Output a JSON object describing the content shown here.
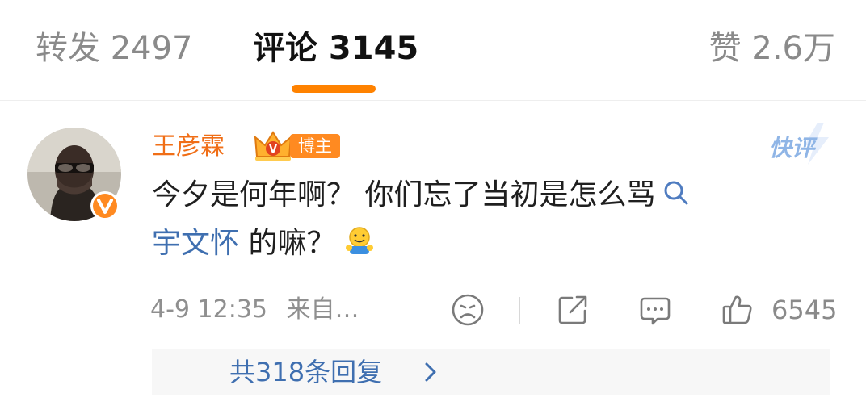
{
  "tabs": {
    "repost": "转发 2497",
    "comments": "评论 3145",
    "likes": "赞 2.6万"
  },
  "comment": {
    "username": "王彦霖",
    "badge_label": "博主",
    "quick_review": "快评",
    "text_line1": "今夕是何年啊？ 你们忘了当初是怎么骂",
    "mention_link": "宇文怀",
    "text_line2_tail": " 的嘛？",
    "time": "4-9 12:35",
    "source": "来自…",
    "like_count": "6545",
    "reply_link": "共318条回复"
  },
  "icons": {
    "avatar": "avatar-photo",
    "verified": "verified-v-icon",
    "search": "search-icon",
    "emoji": "hug-emoji-icon",
    "dislike": "sad-face-icon",
    "share": "share-icon",
    "reply": "comment-bubble-icon",
    "like": "thumbs-up-icon",
    "chevron": "chevron-right-icon"
  },
  "colors": {
    "accent": "#ff8200",
    "username": "#f06e16",
    "link": "#3f6fb0",
    "muted": "#8a8a8a"
  }
}
